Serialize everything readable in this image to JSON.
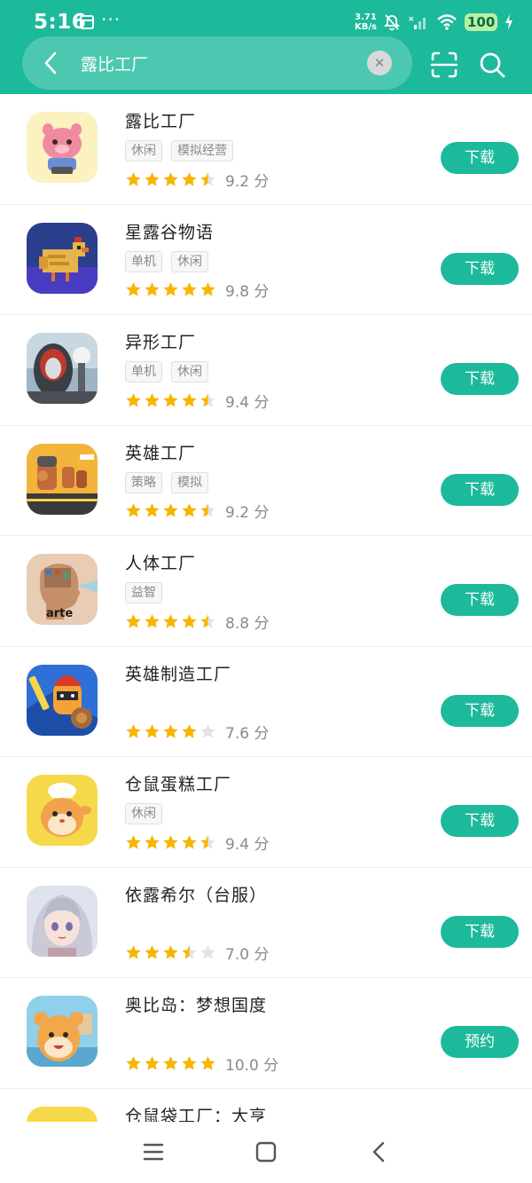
{
  "status_bar": {
    "time": "5:16",
    "net_speed_value": "3.71",
    "net_speed_unit": "KB/s",
    "battery": "100"
  },
  "search": {
    "query": "露比工厂"
  },
  "icons": {
    "back": "chevron-left-icon",
    "clear": "close-icon",
    "scan": "scan-icon",
    "search": "search-icon",
    "menu": "menu-icon",
    "home": "home-icon",
    "nav_back": "back-icon"
  },
  "colors": {
    "accent": "#1cb99a",
    "star": "#f7b500",
    "star_empty": "#e3e3e3"
  },
  "apps": [
    {
      "name": "露比工厂",
      "tags": [
        "休闲",
        "模拟经营"
      ],
      "stars": 4.5,
      "score": "9.2 分",
      "action": "下载"
    },
    {
      "name": "星露谷物语",
      "tags": [
        "单机",
        "休闲"
      ],
      "stars": 5,
      "score": "9.8 分",
      "action": "下载"
    },
    {
      "name": "异形工厂",
      "tags": [
        "单机",
        "休闲"
      ],
      "stars": 4.5,
      "score": "9.4 分",
      "action": "下载"
    },
    {
      "name": "英雄工厂",
      "tags": [
        "策略",
        "模拟"
      ],
      "stars": 4.5,
      "score": "9.2 分",
      "action": "下载"
    },
    {
      "name": "人体工厂",
      "tags": [
        "益智"
      ],
      "stars": 4.5,
      "score": "8.8 分",
      "action": "下载",
      "icon_text": "arte"
    },
    {
      "name": "英雄制造工厂",
      "tags": [],
      "stars": 4,
      "score": "7.6 分",
      "action": "下载"
    },
    {
      "name": "仓鼠蛋糕工厂",
      "tags": [
        "休闲"
      ],
      "stars": 4.5,
      "score": "9.4 分",
      "action": "下载"
    },
    {
      "name": "依露希尔（台服）",
      "tags": [],
      "stars": 3.5,
      "score": "7.0 分",
      "action": "下载"
    },
    {
      "name": "奥比岛：梦想国度",
      "tags": [],
      "stars": 5,
      "score": "10.0 分",
      "action": "预约"
    },
    {
      "name": "仓鼠袋工厂：大亨",
      "tags": [],
      "stars": 0,
      "score": "",
      "action": ""
    }
  ]
}
